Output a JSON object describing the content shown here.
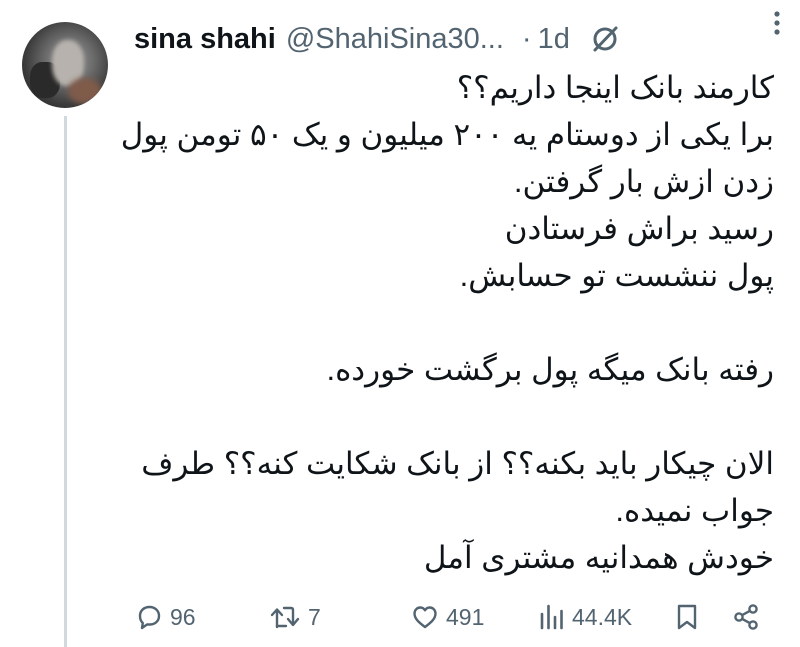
{
  "tweet": {
    "author": {
      "display_name": "sina shahi",
      "handle": "@ShahiSina30...",
      "avatar": "blurred-profile-photo"
    },
    "separator": "·",
    "time": "1d",
    "icons": {
      "grok": "grok-slash-circle-icon",
      "more": "more-vertical-dots-icon"
    },
    "text_lines": [
      "کارمند بانک اینجا داریم؟؟",
      "برا یکی از دوستام یه ۲۰۰ میلیون و یک ۵۰ تومن پول",
      "زدن ازش بار گرفتن.",
      "رسید براش فرستادن",
      "پول ننشست تو حسابش.",
      "",
      "رفته بانک میگه پول برگشت خورده.",
      "",
      "الان چیکار باید بکنه؟؟ از بانک شکایت کنه؟؟ طرف",
      "جواب نمیده.",
      "خودش همدانیه مشتری آمل"
    ],
    "actions": {
      "replies": "96",
      "reposts": "7",
      "likes": "491",
      "views": "44.4K"
    }
  }
}
